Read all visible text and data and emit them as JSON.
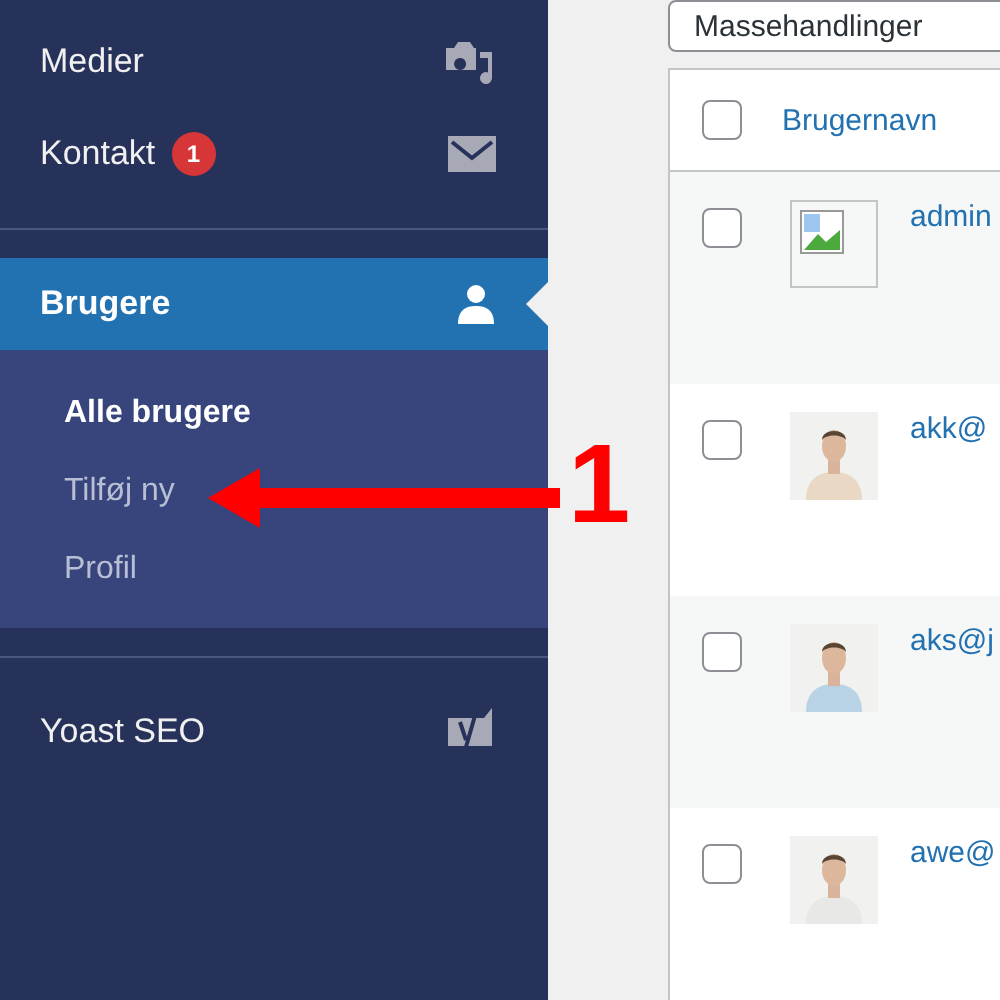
{
  "sidebar": {
    "items": [
      {
        "label": "Medier",
        "selected": false
      },
      {
        "label": "Kontakt",
        "badge": "1",
        "selected": false
      },
      {
        "label": "Brugere",
        "selected": true,
        "children": [
          {
            "label": "Alle brugere",
            "selected": true
          },
          {
            "label": "Tilføj ny",
            "selected": false
          },
          {
            "label": "Profil",
            "selected": false
          }
        ]
      },
      {
        "label": "Yoast SEO",
        "selected": false
      }
    ]
  },
  "bulk_actions": {
    "value": "Massehandlinger"
  },
  "table": {
    "header_checked": false,
    "columns": [
      "Brugernavn"
    ],
    "rows": [
      {
        "username": "admin",
        "checked": false,
        "kind": "broken"
      },
      {
        "username": "akk@",
        "checked": false,
        "kind": "picture"
      },
      {
        "username": "aks@j",
        "checked": false,
        "kind": "picture"
      },
      {
        "username": "awe@",
        "checked": false,
        "kind": "picture"
      }
    ]
  },
  "annotation": {
    "label": "1"
  }
}
